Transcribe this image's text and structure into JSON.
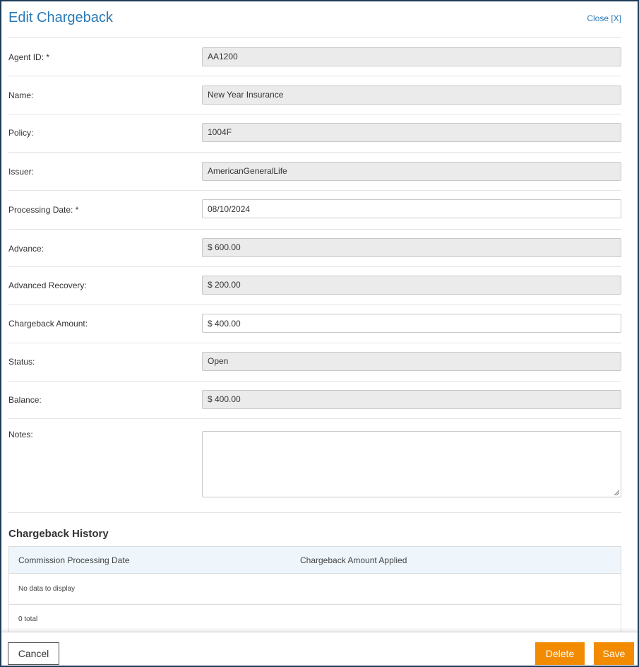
{
  "header": {
    "title": "Edit Chargeback",
    "close_label": "Close [X]"
  },
  "form": {
    "agent_id": {
      "label": "Agent ID: *",
      "value": "AA1200"
    },
    "name": {
      "label": "Name:",
      "value": "New Year Insurance"
    },
    "policy": {
      "label": "Policy:",
      "value": "1004F"
    },
    "issuer": {
      "label": "Issuer:",
      "value": "AmericanGeneralLife"
    },
    "processing_date": {
      "label": "Processing Date: *",
      "value": "08/10/2024"
    },
    "advance": {
      "label": "Advance:",
      "value": "$ 600.00"
    },
    "advanced_recovery": {
      "label": "Advanced Recovery:",
      "value": "$ 200.00"
    },
    "chargeback_amount": {
      "label": "Chargeback Amount:",
      "value": "$ 400.00"
    },
    "status": {
      "label": "Status:",
      "value": "Open"
    },
    "balance": {
      "label": "Balance:",
      "value": "$ 400.00"
    },
    "notes": {
      "label": "Notes:",
      "value": ""
    }
  },
  "history": {
    "title": "Chargeback History",
    "columns": [
      "Commission Processing Date",
      "Chargeback Amount Applied"
    ],
    "empty_text": "No data to display",
    "total_text": "0 total"
  },
  "footer": {
    "cancel_label": "Cancel",
    "delete_label": "Delete",
    "save_label": "Save"
  },
  "colors": {
    "accent": "#2a7ab8",
    "button_orange": "#f28b00",
    "readonly_bg": "#ebebeb",
    "grid_header_bg": "#eef6fc"
  }
}
